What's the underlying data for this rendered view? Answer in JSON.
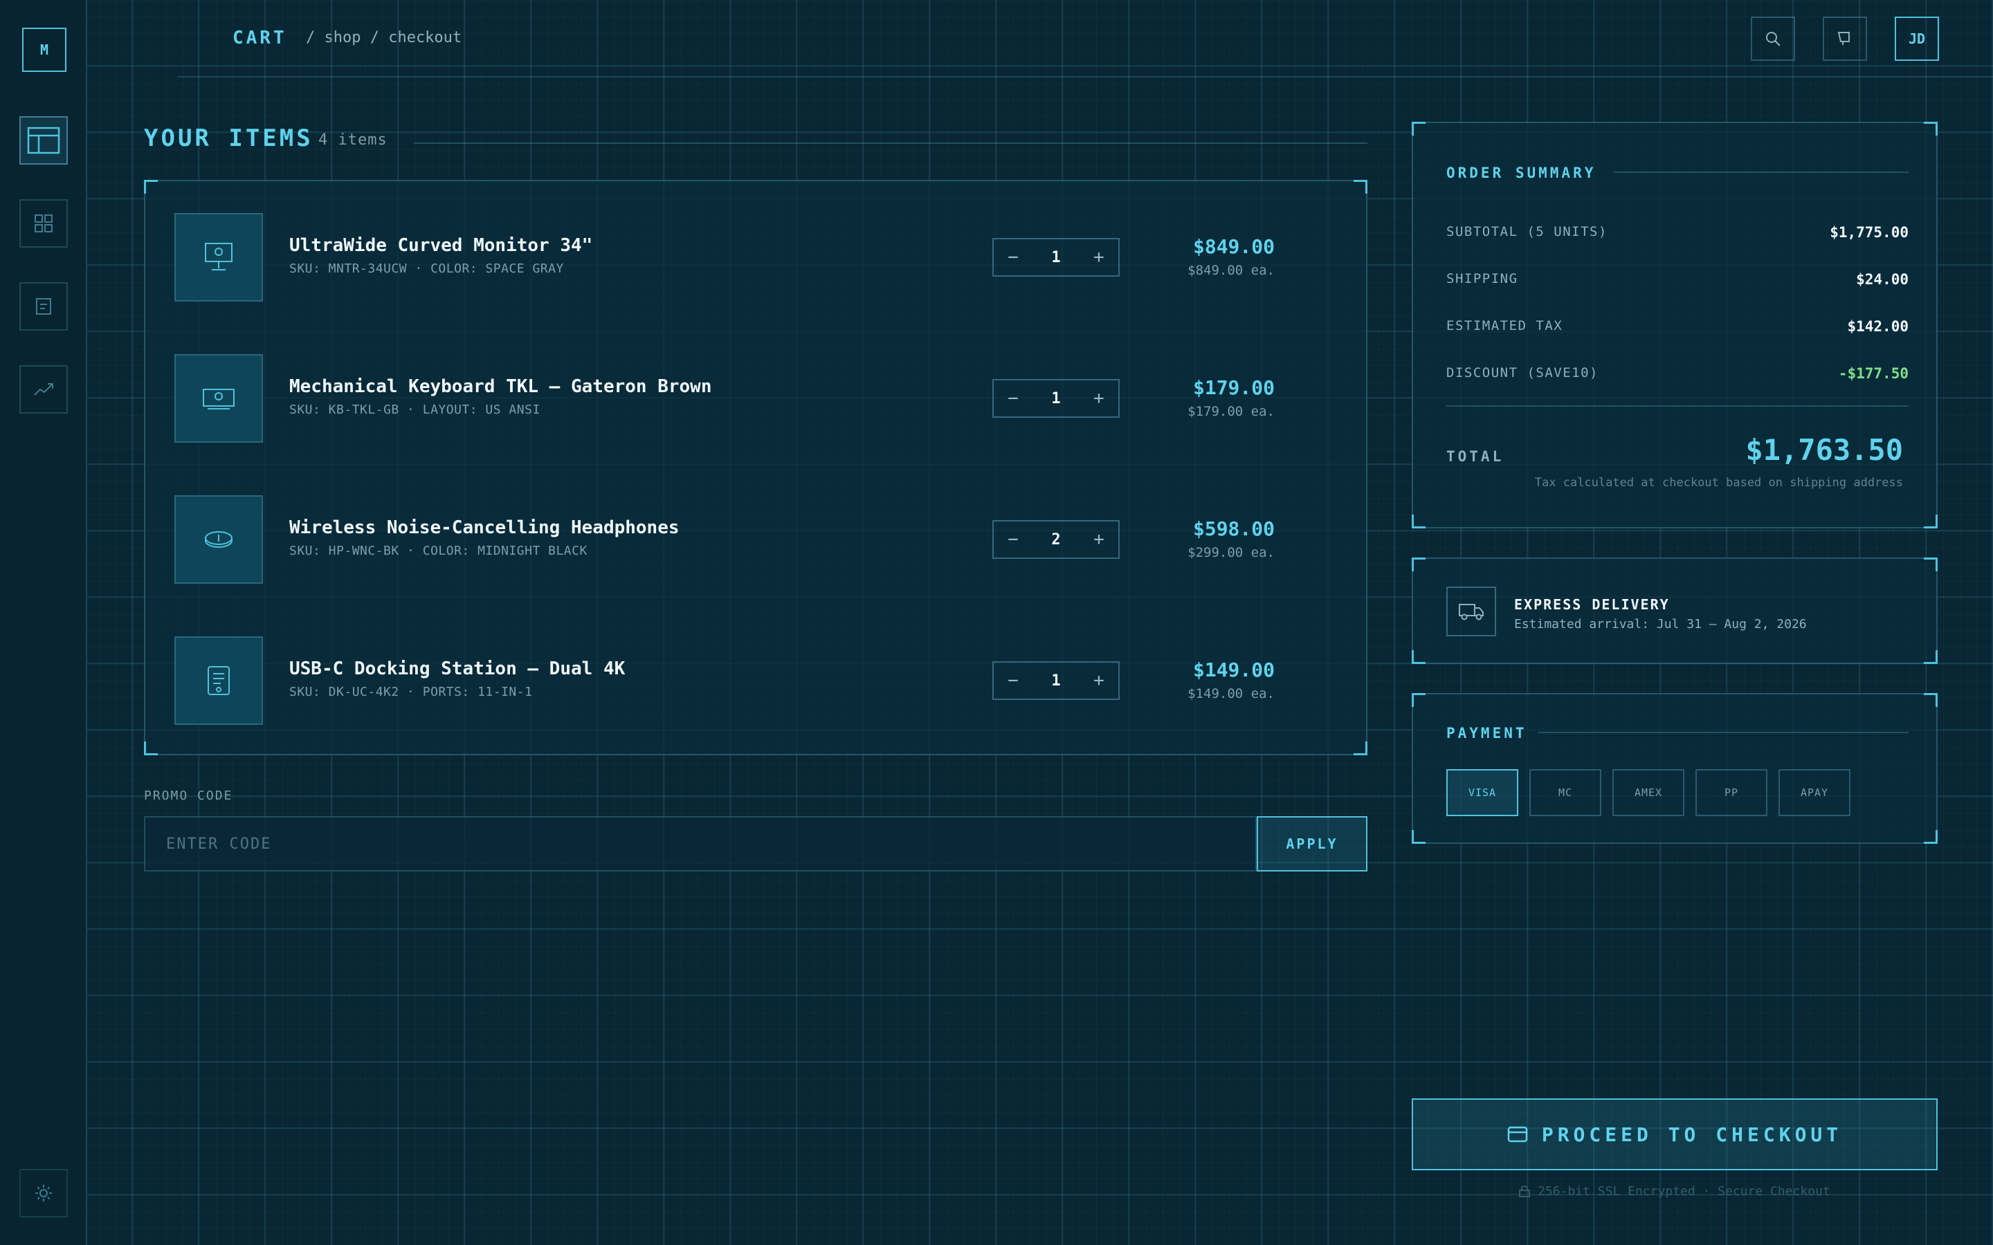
{
  "sidebar": {
    "logo": "M"
  },
  "topbar": {
    "title": "CART",
    "path": "/ shop / checkout",
    "avatar": "JD"
  },
  "items_section": {
    "title": "YOUR ITEMS",
    "count": "4 items"
  },
  "items": [
    {
      "name": "UltraWide Curved Monitor 34\"",
      "meta": "SKU: MNTR-34UCW  ·  COLOR: SPACE GRAY",
      "qty": "1",
      "price": "$849.00",
      "unit": "$849.00 ea.",
      "icon": "monitor-icon"
    },
    {
      "name": "Mechanical Keyboard TKL — Gateron Brown",
      "meta": "SKU: KB-TKL-GB  ·  LAYOUT: US ANSI",
      "qty": "1",
      "price": "$179.00",
      "unit": "$179.00 ea.",
      "icon": "keyboard-icon"
    },
    {
      "name": "Wireless Noise-Cancelling Headphones",
      "meta": "SKU: HP-WNC-BK  ·  COLOR: MIDNIGHT BLACK",
      "qty": "2",
      "price": "$598.00",
      "unit": "$299.00 ea.",
      "icon": "headphones-icon"
    },
    {
      "name": "USB-C Docking Station — Dual 4K",
      "meta": "SKU: DK-UC-4K2  ·  PORTS: 11-IN-1",
      "qty": "1",
      "price": "$149.00",
      "unit": "$149.00 ea.",
      "icon": "dock-icon"
    }
  ],
  "stepper": {
    "minus": "−",
    "plus": "+"
  },
  "promo": {
    "label": "PROMO CODE",
    "placeholder": "ENTER CODE",
    "apply": "APPLY"
  },
  "summary": {
    "title": "ORDER SUMMARY",
    "rows": [
      {
        "label": "SUBTOTAL (5 UNITS)",
        "value": "$1,775.00"
      },
      {
        "label": "SHIPPING",
        "value": "$24.00"
      },
      {
        "label": "ESTIMATED TAX",
        "value": "$142.00"
      },
      {
        "label": "DISCOUNT (SAVE10)",
        "value": "-$177.50"
      }
    ],
    "total_label": "TOTAL",
    "total_value": "$1,763.50",
    "note": "Tax calculated at checkout based on shipping address"
  },
  "delivery": {
    "title": "EXPRESS DELIVERY",
    "subtitle": "Estimated arrival: Jul 31 – Aug 2, 2026"
  },
  "payment": {
    "title": "PAYMENT",
    "options": [
      "VISA",
      "MC",
      "AMEX",
      "PP",
      "APAY"
    ],
    "selected": "VISA"
  },
  "checkout": {
    "label": "PROCEED TO CHECKOUT",
    "secure": "256-bit SSL Encrypted · Secure Checkout"
  },
  "colors": {
    "accent": "#5fd3ec",
    "discount": "#7ee08a",
    "background": "#082633"
  }
}
